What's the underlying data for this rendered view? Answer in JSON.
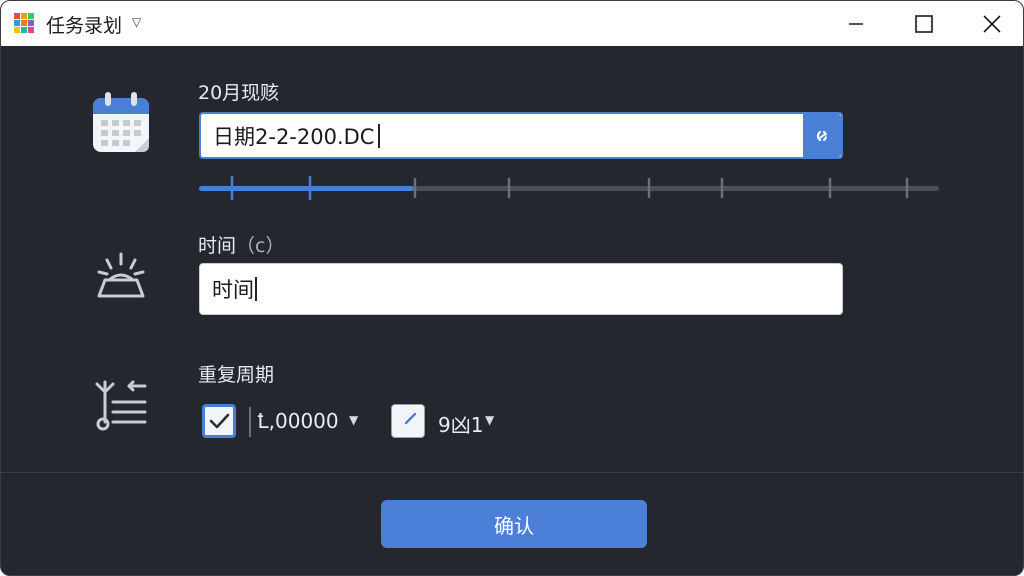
{
  "window": {
    "title": "任务录划",
    "colors": {
      "accent": "#4a7fd6",
      "background": "#24272d",
      "titlebar": "#ffffff"
    }
  },
  "date_section": {
    "label": "20月现赅",
    "value": "日期2-2-200.DC",
    "slider_fraction": 0.29,
    "icon": "calendar-icon"
  },
  "time_section": {
    "label_main": "时间",
    "label_paren": "（c）",
    "value": "时间",
    "icon": "alarm-icon"
  },
  "repeat_section": {
    "label": "重复周期",
    "icon": "repeat-settings-icon",
    "option1": {
      "checked": true,
      "value": "Ꝉ,00000"
    },
    "option2": {
      "checked": false,
      "value": "9凶1"
    }
  },
  "footer": {
    "confirm_label": "确认"
  }
}
